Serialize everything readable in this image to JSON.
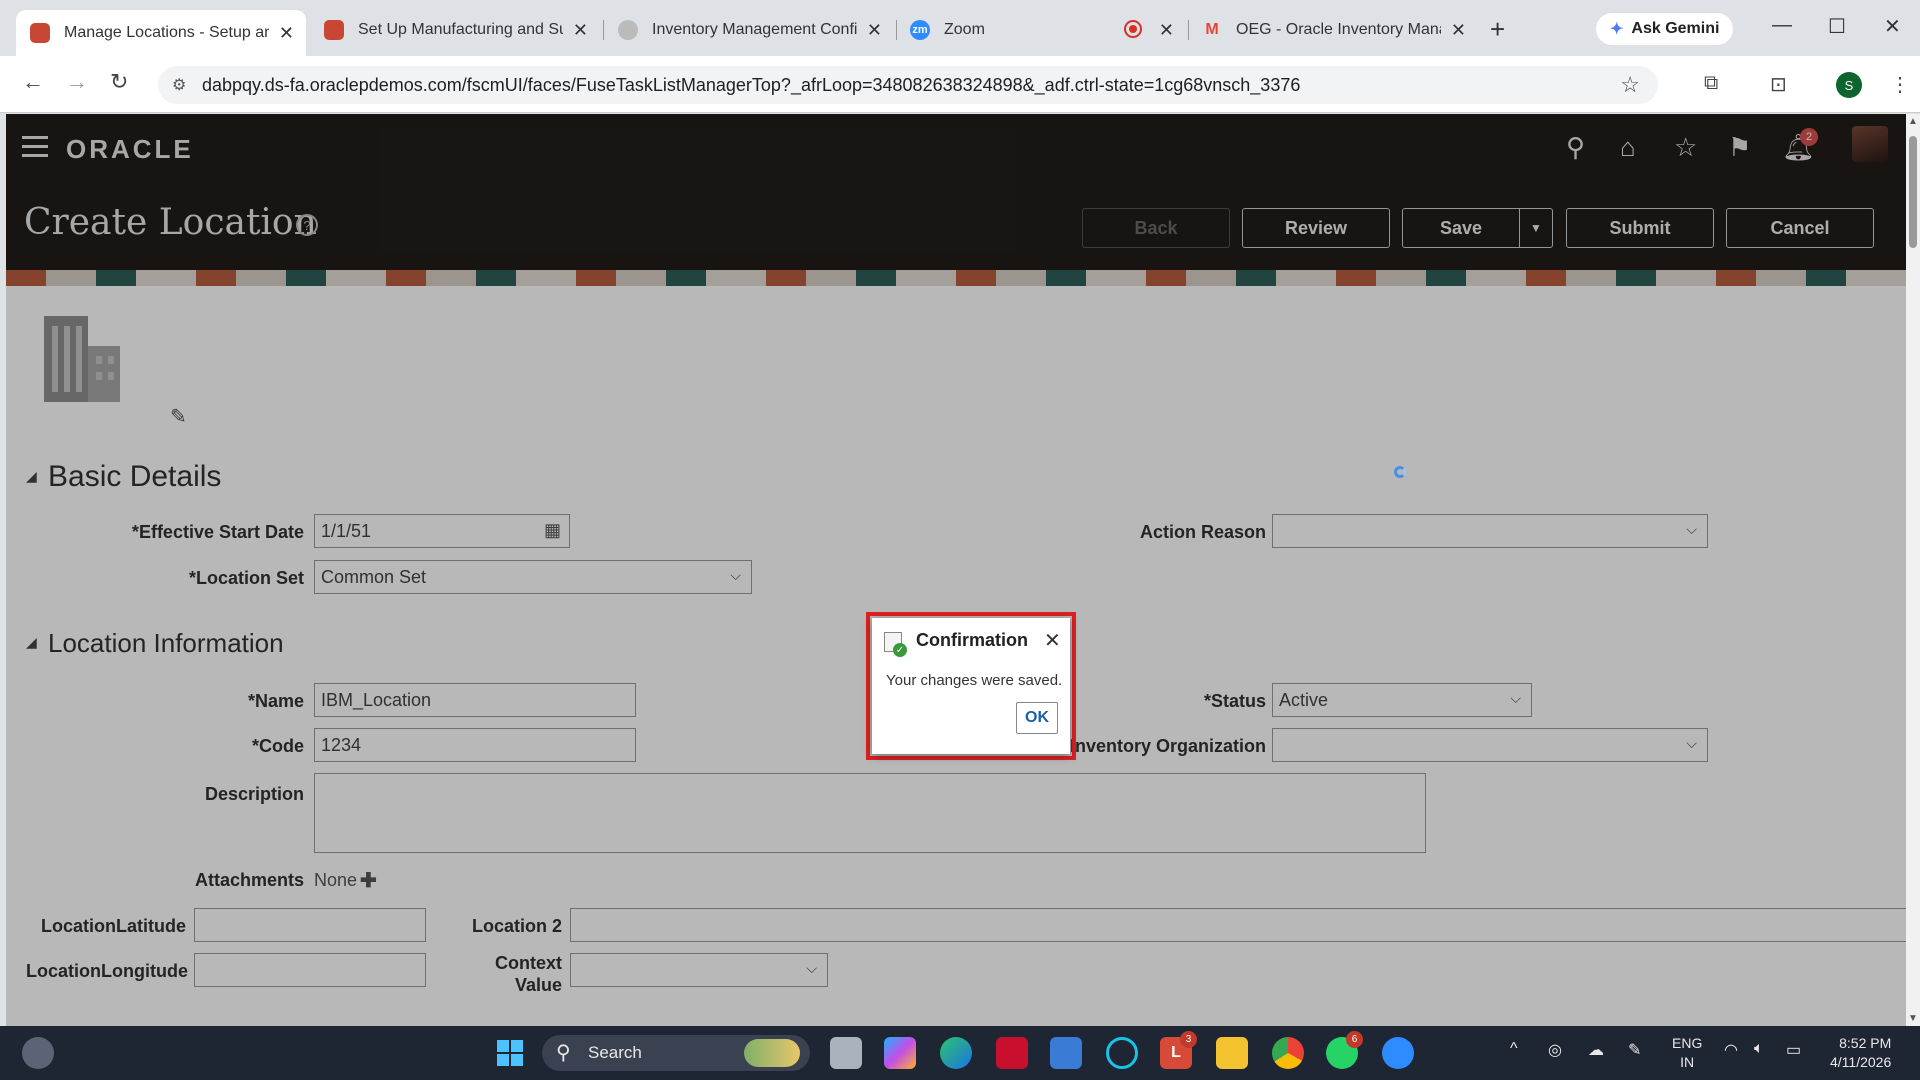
{
  "browser": {
    "tabs": [
      {
        "title": "Manage Locations - Setup and",
        "active": true,
        "favicon_color": "#c74634"
      },
      {
        "title": "Set Up Manufacturing and Sup",
        "active": false,
        "favicon_color": "#c74634"
      },
      {
        "title": "Inventory Management Config",
        "active": false,
        "favicon_color": "#888888"
      },
      {
        "title": "Zoom",
        "active": false,
        "favicon_color": "#2d8cff"
      },
      {
        "title": "OEG - Oracle Inventory Manag",
        "active": false,
        "favicon_color": "#ea4335"
      }
    ],
    "zoom_favicon_text": "zm",
    "gmail_favicon_text": "M",
    "gemini_label": "Ask Gemini",
    "url": "dabpqy.ds-fa.oraclepdemos.com/fscmUI/faces/FuseTaskListManagerTop?_afrLoop=348082638324898&_adf.ctrl-state=1cg68vnsch_3376",
    "profile_initial": "S"
  },
  "app": {
    "logo": "ORACLE",
    "notification_count": "2",
    "page_title": "Create Location",
    "buttons": {
      "back": "Back",
      "review": "Review",
      "save": "Save",
      "submit": "Submit",
      "cancel": "Cancel"
    },
    "basic_details": {
      "title": "Basic Details",
      "effective_start_date_label": "Effective Start Date",
      "effective_start_date_value": "1/1/51",
      "location_set_label": "Location Set",
      "location_set_value": "Common Set",
      "action_reason_label": "Action Reason",
      "action_reason_value": ""
    },
    "location_information": {
      "title": "Location Information",
      "name_label": "Name",
      "name_value": "IBM_Location",
      "code_label": "Code",
      "code_value": "1234",
      "description_label": "Description",
      "description_value": "",
      "attachments_label": "Attachments",
      "attachments_value": "None",
      "status_label": "Status",
      "status_value": "Active",
      "inventory_org_label": "Inventory Organization",
      "inventory_org_value": "",
      "latitude_label": "LocationLatitude",
      "longitude_label": "LocationLongitude",
      "location2_label": "Location 2",
      "context_value_label_1": "Context",
      "context_value_label_2": "Value"
    },
    "required_marker": "*"
  },
  "dialog": {
    "title": "Confirmation",
    "message": "Your changes were saved.",
    "ok": "OK",
    "highlight_color": "#e02020"
  },
  "taskbar": {
    "search_label": "Search",
    "badges": {
      "lens": "3",
      "whatsapp": "6"
    },
    "lang_1": "ENG",
    "lang_2": "IN",
    "time": "8:52 PM",
    "date": "4/11/2026"
  }
}
